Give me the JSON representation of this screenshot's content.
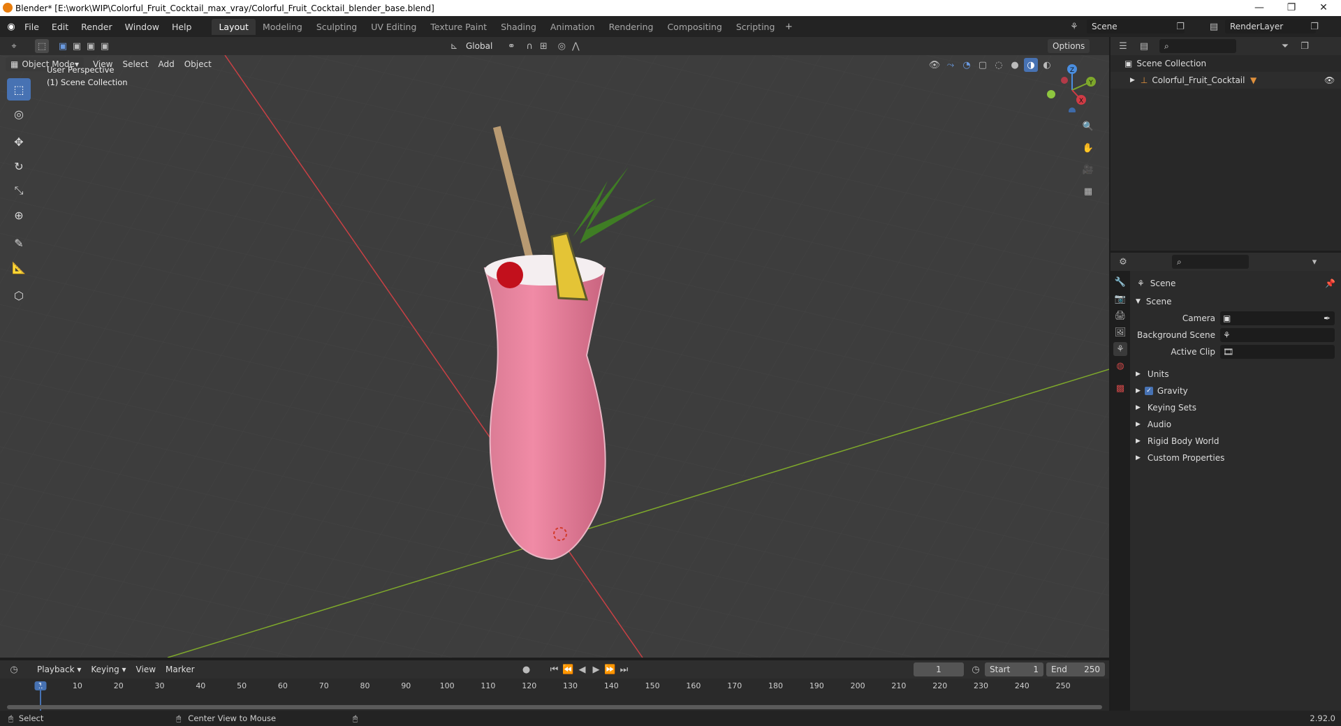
{
  "window": {
    "title": "Blender* [E:\\work\\WIP\\Colorful_Fruit_Cocktail_max_vray/Colorful_Fruit_Cocktail_blender_base.blend]"
  },
  "menu": [
    "File",
    "Edit",
    "Render",
    "Window",
    "Help"
  ],
  "workspaces": [
    "Layout",
    "Modeling",
    "Sculpting",
    "UV Editing",
    "Texture Paint",
    "Shading",
    "Animation",
    "Rendering",
    "Compositing",
    "Scripting"
  ],
  "scene_field": "Scene",
  "renderlayer_field": "RenderLayer",
  "transform": {
    "orientation": "Global",
    "options": "Options"
  },
  "viewport": {
    "mode": "Object Mode",
    "menus": [
      "View",
      "Select",
      "Add",
      "Object"
    ],
    "overlay_line1": "User Perspective",
    "overlay_line2": "(1) Scene Collection",
    "gizmo_axes": [
      "Z",
      "Y",
      "X"
    ]
  },
  "outliner": {
    "root": "Scene Collection",
    "items": [
      {
        "label": "Colorful_Fruit_Cocktail"
      }
    ]
  },
  "properties": {
    "header": "Scene",
    "section": "Scene",
    "fields": [
      {
        "label": "Camera"
      },
      {
        "label": "Background Scene"
      },
      {
        "label": "Active Clip"
      }
    ],
    "panels": [
      "Units",
      "Gravity",
      "Keying Sets",
      "Audio",
      "Rigid Body World",
      "Custom Properties"
    ],
    "gravity_checked": true
  },
  "timeline": {
    "menus": [
      "Playback",
      "Keying",
      "View",
      "Marker"
    ],
    "current_frame": "1",
    "start_label": "Start",
    "start": "1",
    "end_label": "End",
    "end": "250",
    "ticks": [
      "1",
      "10",
      "20",
      "30",
      "40",
      "50",
      "60",
      "70",
      "80",
      "90",
      "100",
      "110",
      "120",
      "130",
      "140",
      "150",
      "160",
      "170",
      "180",
      "190",
      "200",
      "210",
      "220",
      "230",
      "240",
      "250"
    ]
  },
  "status": {
    "left": "Select",
    "mid": "Center View to Mouse",
    "version": "2.92.0"
  },
  "colors": {
    "accent": "#4772b3",
    "x_axis": "#c94044",
    "y_axis": "#7ea82b",
    "grid_bg": "#3d3d3d"
  }
}
